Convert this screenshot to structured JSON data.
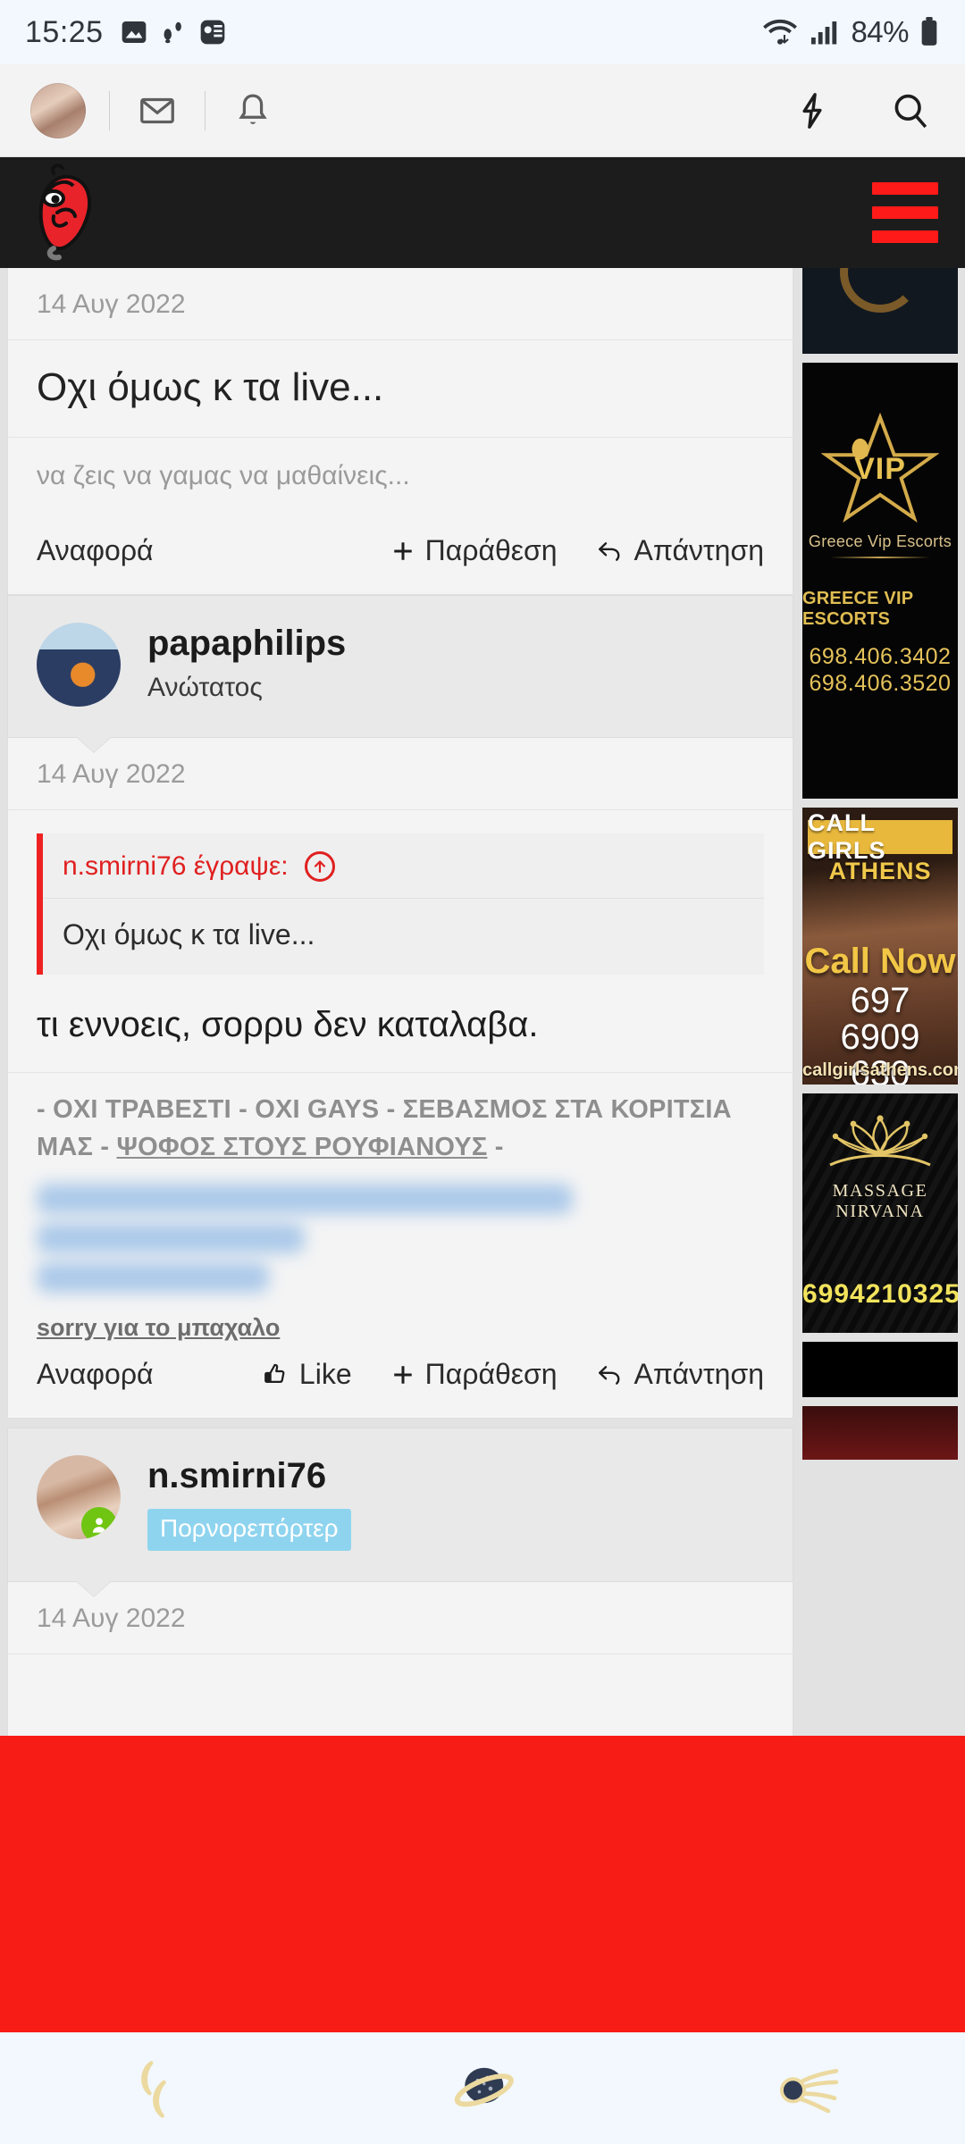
{
  "status_bar": {
    "time": "15:25",
    "left_icons": [
      "image-icon",
      "footsteps-icon",
      "app-icon"
    ],
    "right_icons": [
      "wifi-icon",
      "signal-icon"
    ],
    "battery": "84%"
  },
  "browser_chrome": {
    "avatar": "user-avatar",
    "mail_icon": "mail-icon",
    "bell_icon": "bell-icon",
    "bolt_icon": "lightning-icon",
    "search_icon": "search-icon"
  },
  "site_header": {
    "logo": "red-chili-mascot-logo",
    "menu_icon": "hamburger-menu-icon",
    "accent_color": "#ff1a1a",
    "background_color": "#1c1c1c"
  },
  "posts": [
    {
      "date": "14 Αυγ 2022",
      "title": "Οχι όμως κ τα live...",
      "subtitle": "να ζεις να γαμας να μαθαίνεις...",
      "actions": {
        "report": "Αναφορά",
        "quote": "Παράθεση",
        "reply": "Απάντηση"
      }
    },
    {
      "user": {
        "name": "papaphilips",
        "title": "Ανώτατος",
        "avatar": "guitar-player-avatar"
      },
      "date": "14 Αυγ 2022",
      "quote": {
        "header": "n.smirni76 έγραψε:",
        "jump_icon": "jump-to-post-arrow-icon",
        "body": "Οχι όμως κ τα live..."
      },
      "body": "τι εννοεις, σορρυ δεν καταλαβα.",
      "signature_line1": "- ΟΧΙ ΤΡΑΒΕΣΤΙ - ΟΧΙ GAYS - ΣΕΒΑΣΜΟΣ ΣΤΑ ΚΟΡΙΤΣΙΑ",
      "signature_line2_a": "ΜΑΣ - ",
      "signature_line2_b": "ΨΟΦΟΣ ΣΤΟΥΣ ΡΟΥΦΙΑΝΟΥΣ",
      "signature_line2_c": " -",
      "sorry_note": "sorry για το μπαχαλο",
      "actions": {
        "report": "Αναφορά",
        "like": "Like",
        "quote": "Παράθεση",
        "reply": "Απάντηση"
      }
    },
    {
      "user": {
        "name": "n.smirni76",
        "badge": "Πορνορεπόρτερ",
        "badge_color": "#8fd4ef",
        "avatar": "woman-avatar",
        "online": true
      },
      "date": "14 Αυγ 2022"
    }
  ],
  "sidebar_ads": [
    {
      "name": "partial-ad-top"
    },
    {
      "name": "greece-vip-escorts-ad",
      "logo_text": "VIP",
      "caption": "Greece Vip Escorts",
      "title": "GREECE VIP ESCORTS",
      "phone1": "698.406.3402",
      "phone2": "698.406.3520"
    },
    {
      "name": "call-girls-athens-ad",
      "line1": "CALL GIRLS",
      "line2": "ATHENS",
      "cta": "Call Now",
      "phone": "697\n6909\n630",
      "website": "callgirlsathens.com"
    },
    {
      "name": "massage-nirvana-ad",
      "title": "MASSAGE NIRVANA",
      "phone": "6994210325"
    }
  ],
  "overlay": {
    "name": "red-ad-overlay",
    "color": "#f81c16"
  },
  "bottom_nav": {
    "items": [
      {
        "name": "back-crescents-icon"
      },
      {
        "name": "home-planet-icon"
      },
      {
        "name": "recents-comet-icon"
      }
    ]
  }
}
